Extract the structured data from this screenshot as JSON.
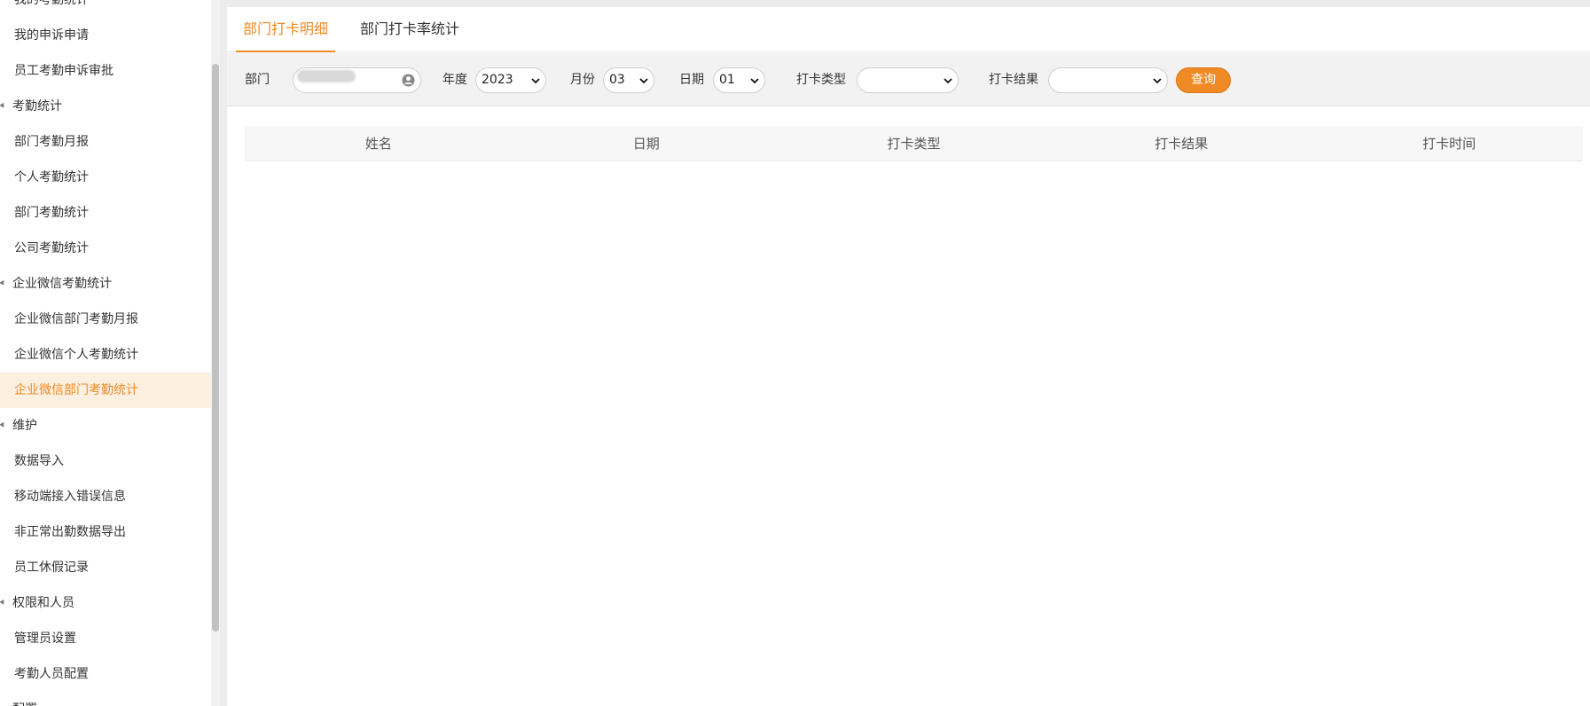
{
  "sidebar": {
    "items": [
      {
        "label": "我的考勤统计",
        "type": "item"
      },
      {
        "label": "我的申诉申请",
        "type": "item"
      },
      {
        "label": "员工考勤申诉审批",
        "type": "item"
      },
      {
        "label": "考勤统计",
        "type": "group"
      },
      {
        "label": "部门考勤月报",
        "type": "item"
      },
      {
        "label": "个人考勤统计",
        "type": "item"
      },
      {
        "label": "部门考勤统计",
        "type": "item"
      },
      {
        "label": "公司考勤统计",
        "type": "item"
      },
      {
        "label": "企业微信考勤统计",
        "type": "group"
      },
      {
        "label": "企业微信部门考勤月报",
        "type": "item"
      },
      {
        "label": "企业微信个人考勤统计",
        "type": "item"
      },
      {
        "label": "企业微信部门考勤统计",
        "type": "item",
        "active": true
      },
      {
        "label": "维护",
        "type": "group"
      },
      {
        "label": "数据导入",
        "type": "item"
      },
      {
        "label": "移动端接入错误信息",
        "type": "item"
      },
      {
        "label": "非正常出勤数据导出",
        "type": "item"
      },
      {
        "label": "员工休假记录",
        "type": "item"
      },
      {
        "label": "权限和人员",
        "type": "group"
      },
      {
        "label": "管理员设置",
        "type": "item"
      },
      {
        "label": "考勤人员配置",
        "type": "item"
      },
      {
        "label": "配置",
        "type": "group"
      }
    ]
  },
  "tabs": [
    {
      "label": "部门打卡明细",
      "active": true
    },
    {
      "label": "部门打卡率统计",
      "active": false
    }
  ],
  "filter": {
    "dept_label": "部门",
    "year_label": "年度",
    "year_value": "2023",
    "month_label": "月份",
    "month_value": "03",
    "day_label": "日期",
    "day_value": "01",
    "type_label": "打卡类型",
    "type_value": "",
    "result_label": "打卡结果",
    "result_value": "",
    "query_label": "查询"
  },
  "table": {
    "columns": [
      "姓名",
      "日期",
      "打卡类型",
      "打卡结果",
      "打卡时间"
    ]
  },
  "colors": {
    "accent": "#f08a24",
    "active_bg": "#fef0e1"
  }
}
